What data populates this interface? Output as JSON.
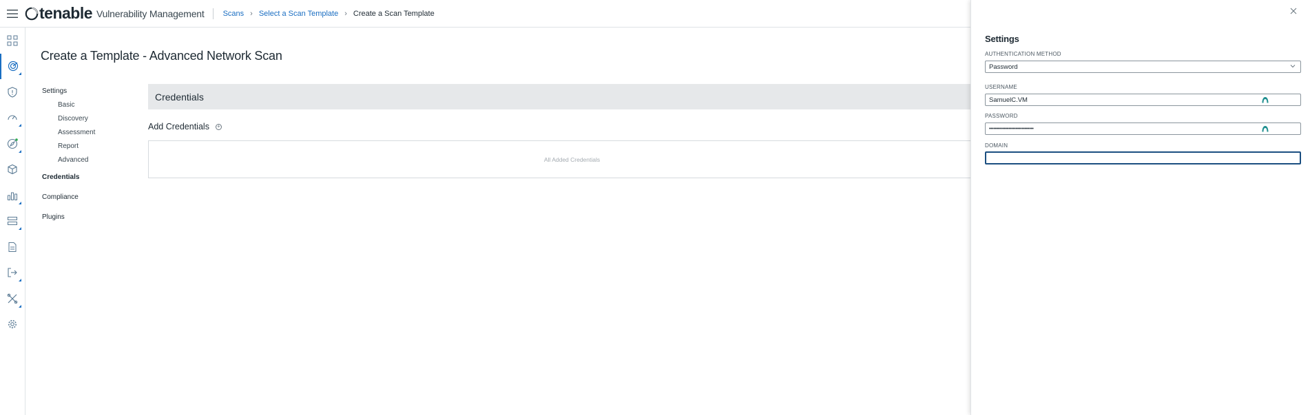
{
  "topbar": {
    "logo_word": "tenable",
    "product_name": "Vulnerability Management",
    "breadcrumb": [
      {
        "label": "Scans",
        "link": true
      },
      {
        "label": "Select a Scan Template",
        "link": true
      },
      {
        "label": "Create a Scan Template",
        "link": false
      }
    ],
    "breadcrumb_sep": "›"
  },
  "leftnav": {
    "items": [
      {
        "name": "dashboard-icon"
      },
      {
        "name": "scans-radar-icon",
        "active": true
      },
      {
        "name": "shield-icon"
      },
      {
        "name": "gauge-icon"
      },
      {
        "name": "compass-icon"
      },
      {
        "name": "cube-icon"
      },
      {
        "name": "analytics-icon"
      },
      {
        "name": "list-icon"
      },
      {
        "name": "report-icon"
      },
      {
        "name": "export-icon"
      },
      {
        "name": "tools-icon"
      },
      {
        "name": "settings-gear-icon"
      }
    ]
  },
  "main": {
    "page_title": "Create a Template - Advanced Network Scan",
    "menu": {
      "settings": "Settings",
      "sub_items": [
        "Basic",
        "Discovery",
        "Assessment",
        "Report",
        "Advanced"
      ],
      "credentials": "Credentials",
      "compliance": "Compliance",
      "plugins": "Plugins"
    },
    "section_header": "Credentials",
    "add_credentials": "Add Credentials",
    "add_icon": "+",
    "empty_box_text": "All Added Credentials"
  },
  "drawer": {
    "title": "Settings",
    "auth_method_label": "AUTHENTICATION METHOD",
    "auth_method_value": "Password",
    "username_label": "USERNAME",
    "username_value": "SamuelC.VM",
    "password_label": "PASSWORD",
    "password_value": "••••••••••••••••••••••••••••••",
    "domain_label": "DOMAIN",
    "domain_value": ""
  },
  "colors": {
    "accent": "#1a6ec2",
    "teal_icon": "#1f8f8f",
    "focus_border": "#1a4e80"
  }
}
